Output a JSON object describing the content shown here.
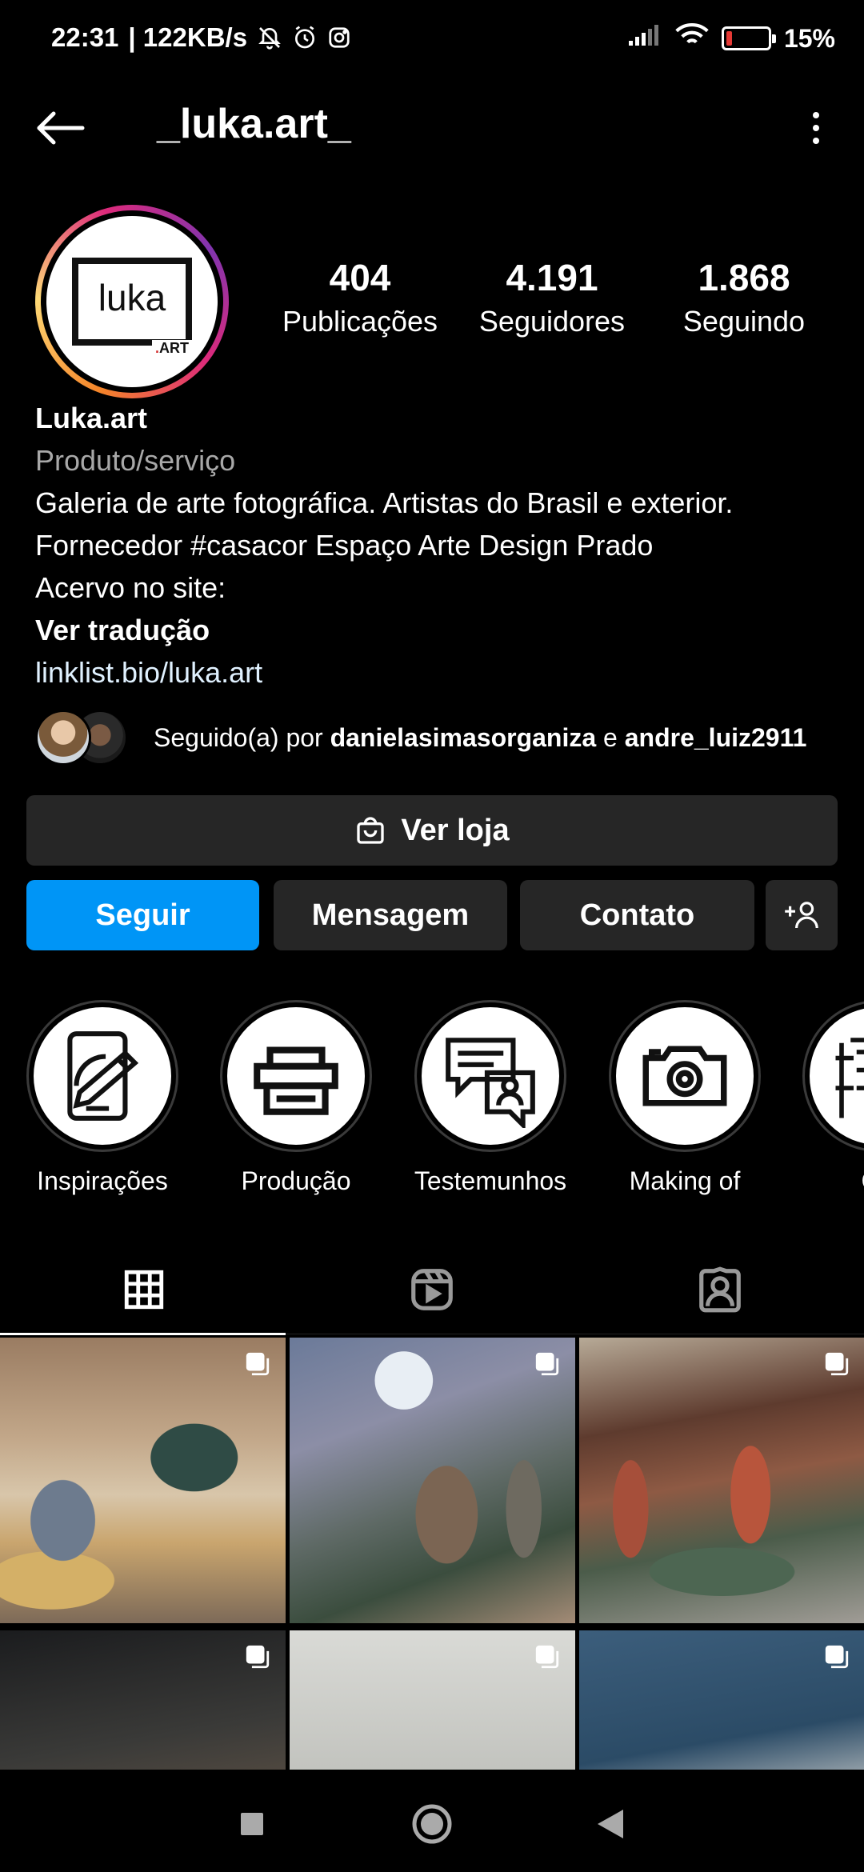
{
  "status_bar": {
    "time": "22:31",
    "network_speed": "| 122KB/s",
    "icons": [
      "mute-bell-icon",
      "alarm-icon",
      "instagram-icon"
    ],
    "battery_percent_label": "15%",
    "battery_level": 0.15,
    "battery_color": "#e53935"
  },
  "top_bar": {
    "username": "_luka.art_",
    "back_icon": "arrow-left-icon",
    "more_icon": "more-vertical-icon"
  },
  "profile": {
    "logo_text": "luka",
    "logo_sub": "ART",
    "stats": [
      {
        "value": "404",
        "label": "Publicações"
      },
      {
        "value": "4.191",
        "label": "Seguidores"
      },
      {
        "value": "1.868",
        "label": "Seguindo"
      }
    ],
    "name": "Luka.art",
    "category": "Produto/serviço",
    "bio_lines": [
      "Galeria de arte fotográfica. Artistas do Brasil e exterior.",
      "Fornecedor #casacor Espaço Arte Design Prado",
      "Acervo no site:"
    ],
    "translate": "Ver tradução",
    "link": "linklist.bio/luka.art",
    "followed_by": {
      "prefix": "Seguido(a) por",
      "user1": "danielasimasorganiza",
      "connector": "e",
      "user2": "andre_luiz2911"
    }
  },
  "buttons": {
    "shop": "Ver loja",
    "follow": "Seguir",
    "message": "Mensagem",
    "contact": "Contato",
    "follow_color": "#0095f6"
  },
  "highlights": [
    {
      "label": "Inspirações",
      "icon": "tablet-pencil-icon"
    },
    {
      "label": "Produção",
      "icon": "printer-icon"
    },
    {
      "label": "Testemunhos",
      "icon": "chat-bubbles-icon"
    },
    {
      "label": "Making of",
      "icon": "camera-icon"
    },
    {
      "label": "Ori",
      "icon": "building-icon"
    }
  ],
  "tabs": [
    {
      "name": "grid",
      "icon": "grid-icon",
      "active": true
    },
    {
      "name": "reels",
      "icon": "reels-icon",
      "active": false
    },
    {
      "name": "tagged",
      "icon": "tagged-person-icon",
      "active": false
    }
  ],
  "posts": [
    {
      "name": "post-living-room",
      "multi": true
    },
    {
      "name": "post-women-blue-room",
      "multi": true
    },
    {
      "name": "post-restaurant-green-sofa",
      "multi": true
    },
    {
      "name": "post-dark-room-men",
      "multi": true
    },
    {
      "name": "post-white-gallery",
      "multi": true
    },
    {
      "name": "post-blue-suits",
      "multi": true
    }
  ],
  "nav_bar": {
    "icons": [
      "recents-square-icon",
      "home-circle-icon",
      "back-triangle-icon"
    ]
  }
}
